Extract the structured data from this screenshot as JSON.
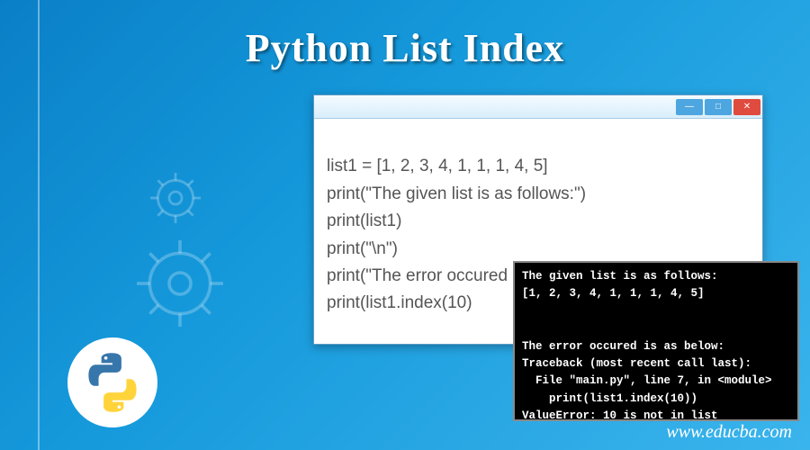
{
  "title": "Python List Index",
  "url": "www.educba.com",
  "code_lines": [
    "list1 = [1, 2, 3, 4, 1, 1, 1, 4, 5]",
    "print(\"The given list is as follows:\")",
    "print(list1)",
    "print(\"\\n\")",
    "print(\"The error occured is as below:\")",
    "print(list1.index(10)"
  ],
  "terminal_lines": [
    "The given list is as follows:",
    "[1, 2, 3, 4, 1, 1, 1, 4, 5]",
    "",
    "",
    "The error occured is as below:",
    "Traceback (most recent call last):",
    "  File \"main.py\", line 7, in <module>",
    "    print(list1.index(10))",
    "ValueError: 10 is not in list"
  ],
  "window": {
    "min": "—",
    "max": "□",
    "close": "✕"
  }
}
